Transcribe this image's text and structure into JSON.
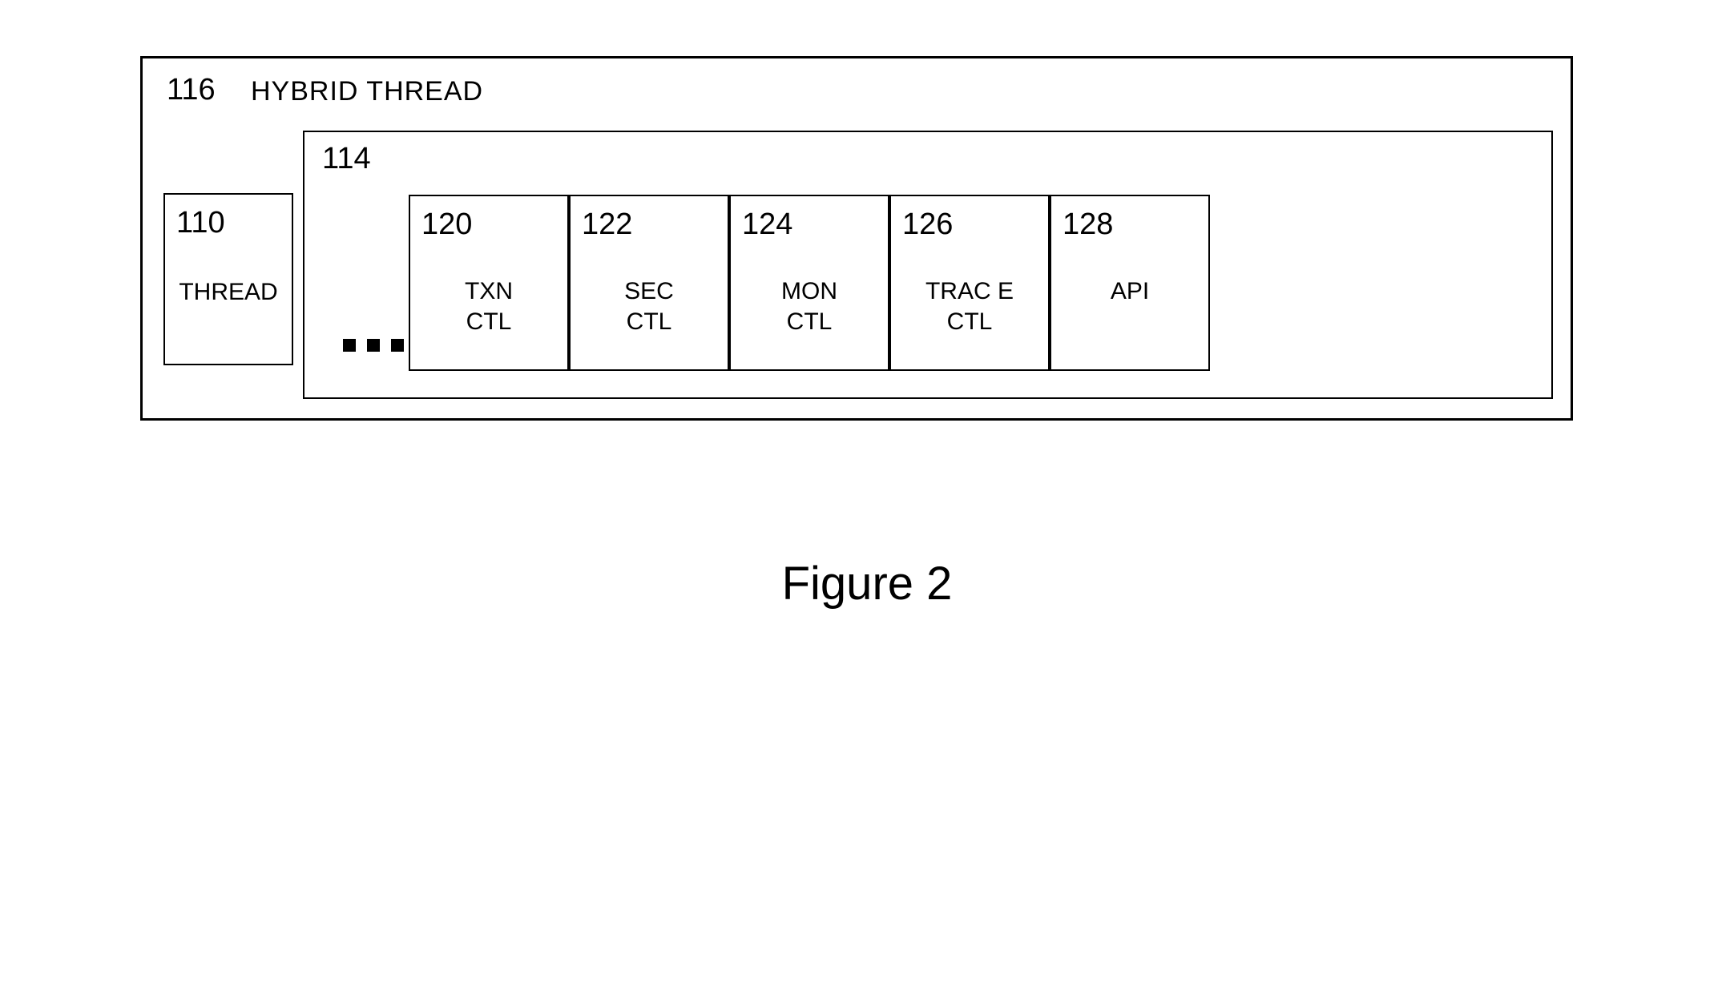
{
  "outer": {
    "ref": "116",
    "title": "HYBRID THREAD"
  },
  "thread": {
    "ref": "110",
    "label": "THREAD"
  },
  "container": {
    "ref": "114"
  },
  "modules": {
    "m120": {
      "ref": "120",
      "label": "TXN\nCTL"
    },
    "m122": {
      "ref": "122",
      "label": "SEC\nCTL"
    },
    "m124": {
      "ref": "124",
      "label": "MON\nCTL"
    },
    "m126": {
      "ref": "126",
      "label": "TRAC E\nCTL"
    },
    "m128": {
      "ref": "128",
      "label": "API"
    }
  },
  "caption": "Figure 2"
}
